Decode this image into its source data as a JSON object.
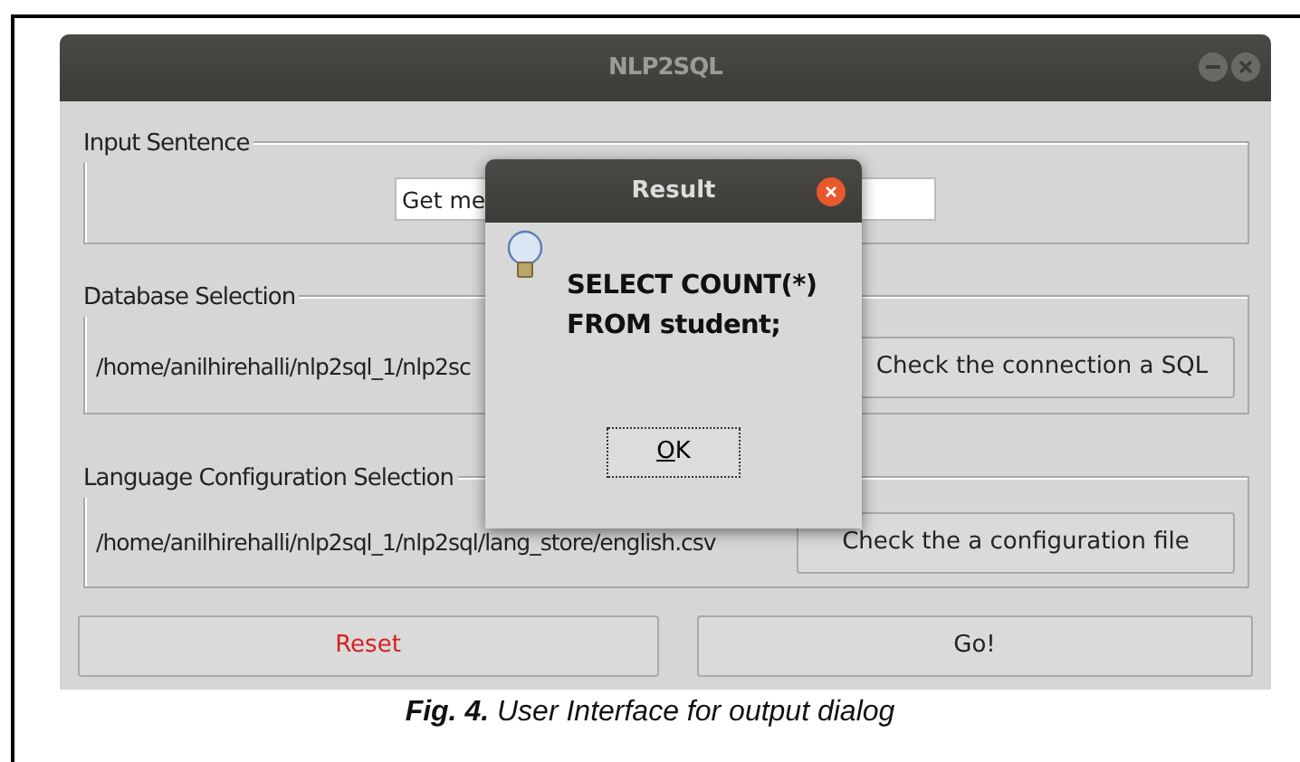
{
  "window": {
    "title": "NLP2SQL"
  },
  "input_group": {
    "legend": "Input Sentence",
    "value": "Get me"
  },
  "database_group": {
    "legend": "Database Selection",
    "path": "/home/anilhirehalli/nlp2sql_1/nlp2sc",
    "button": "Check the connection a SQL"
  },
  "language_group": {
    "legend": "Language Configuration Selection",
    "path": "/home/anilhirehalli/nlp2sql_1/nlp2sql/lang_store/english.csv",
    "button": "Check the a configuration file"
  },
  "actions": [
    {
      "label": "Reset",
      "kind": "danger"
    },
    {
      "label": "Go!",
      "kind": "normal"
    }
  ],
  "dialog": {
    "title": "Result",
    "message_lines": [
      "SELECT COUNT(*)",
      "FROM student;"
    ],
    "button": "OK"
  },
  "caption": "**Fig. 4.** User Interface for output dialog"
}
